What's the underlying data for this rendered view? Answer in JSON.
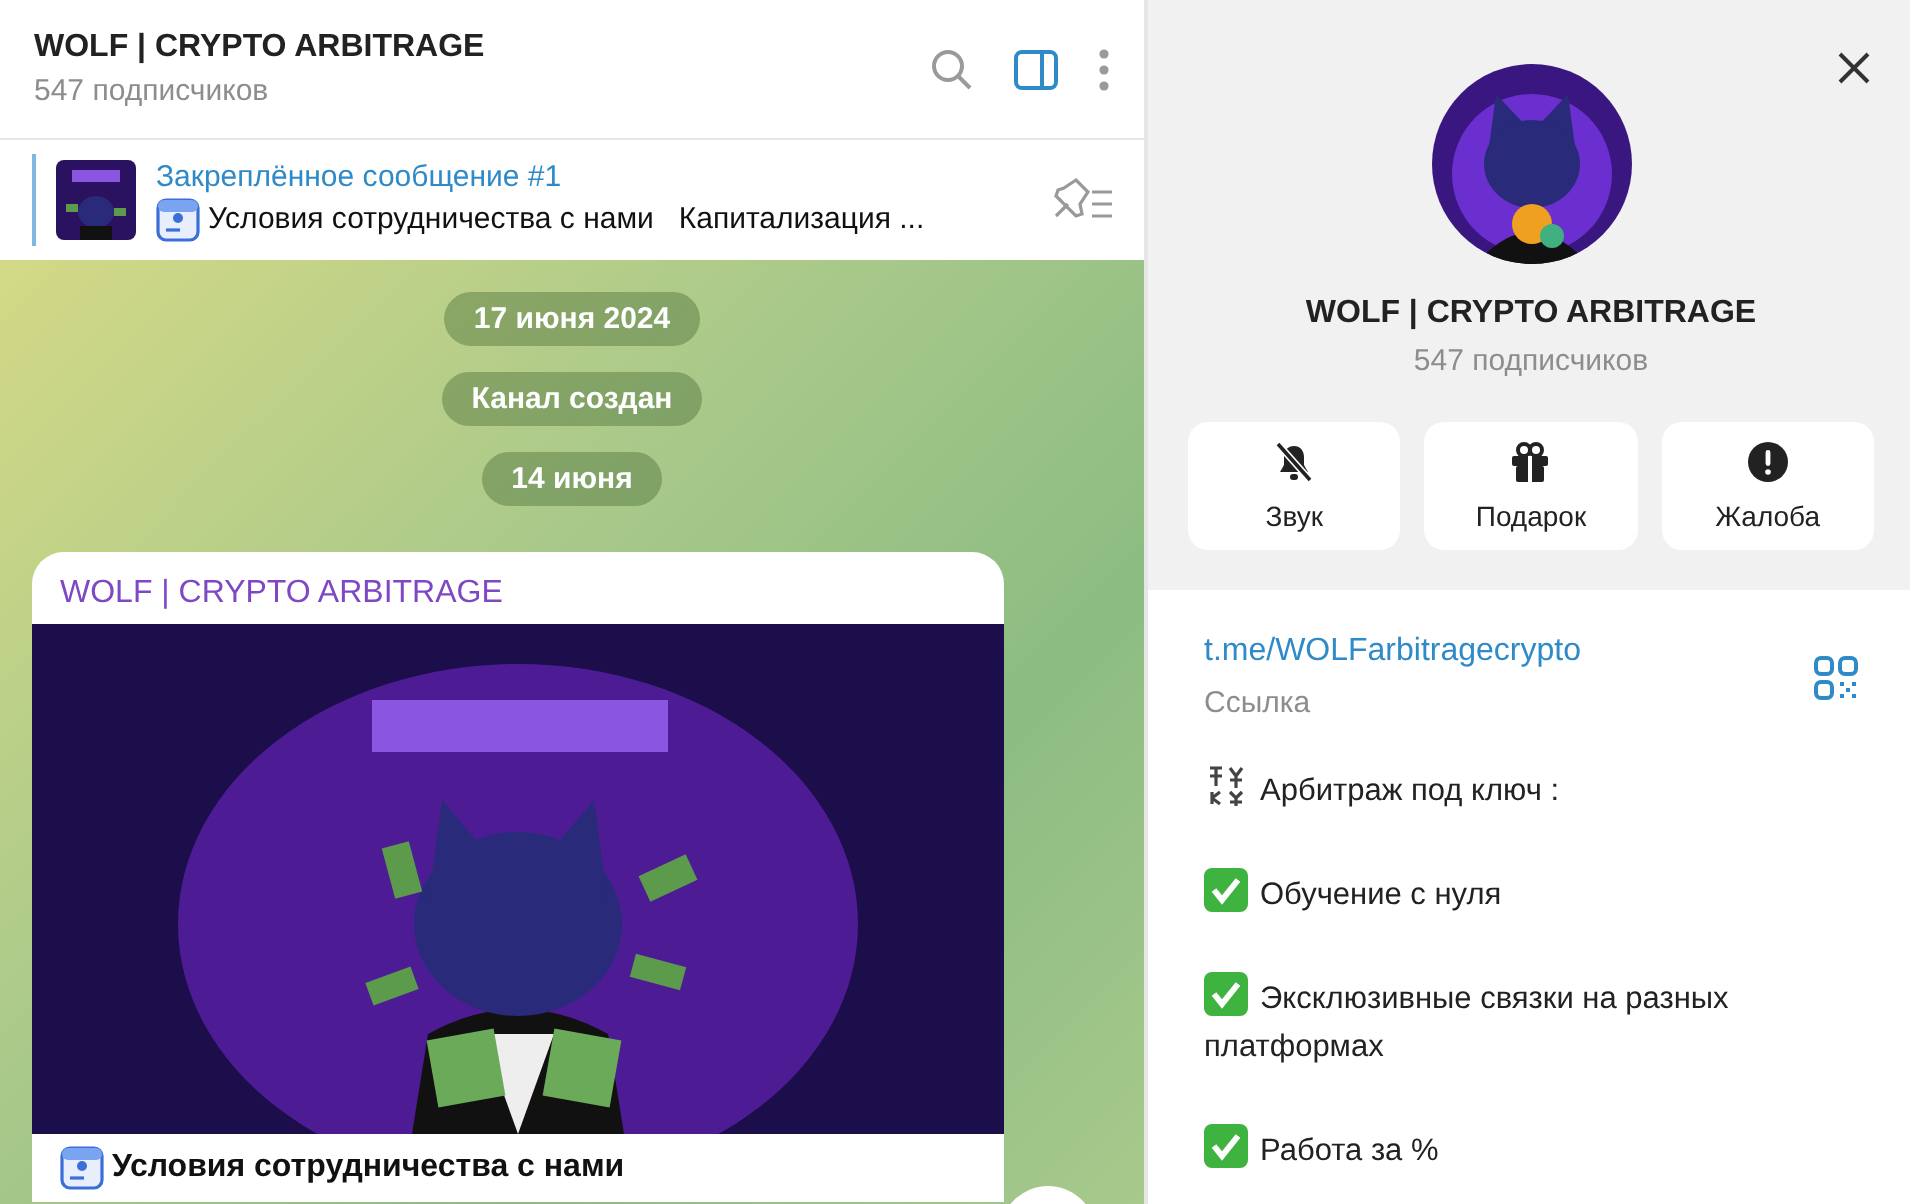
{
  "header": {
    "title": "WOLF | CRYPTO ARBITRAGE",
    "subtitle": "547 подписчиков"
  },
  "toolbar": [
    {
      "kind": "search",
      "selected": false
    },
    {
      "kind": "sidebar",
      "selected": true
    },
    {
      "kind": "more",
      "selected": false
    }
  ],
  "pinned": {
    "title": "Закреплённое сообщение #1",
    "text": "Условия сотрудничества с нами   Капитализация ..."
  },
  "service": [
    {
      "text": "17 июня 2024"
    },
    {
      "text": "Канал создан"
    },
    {
      "text": "14 июня"
    }
  ],
  "post": {
    "author": "WOLF | CRYPTO ARBITRAGE",
    "caption": "Условия сотрудничества с нами"
  },
  "profile": {
    "title": "WOLF | CRYPTO ARBITRAGE",
    "subtitle": "547 подписчиков",
    "actions": [
      {
        "kind": "mute",
        "label": "Звук"
      },
      {
        "kind": "gift",
        "label": "Подарок"
      },
      {
        "kind": "report",
        "label": "Жалоба"
      }
    ],
    "link": "t.me/WOLFarbitragecrypto",
    "link_label": "Ссылка",
    "description": [
      {
        "kind": "exchange",
        "text": "Арбитраж под ключ :"
      },
      {
        "kind": "check",
        "text": "Обучение с нуля"
      },
      {
        "kind": "check",
        "text": "Эксклюзивные связки на разных платформах"
      },
      {
        "kind": "check",
        "text": "Работа за %"
      }
    ]
  }
}
